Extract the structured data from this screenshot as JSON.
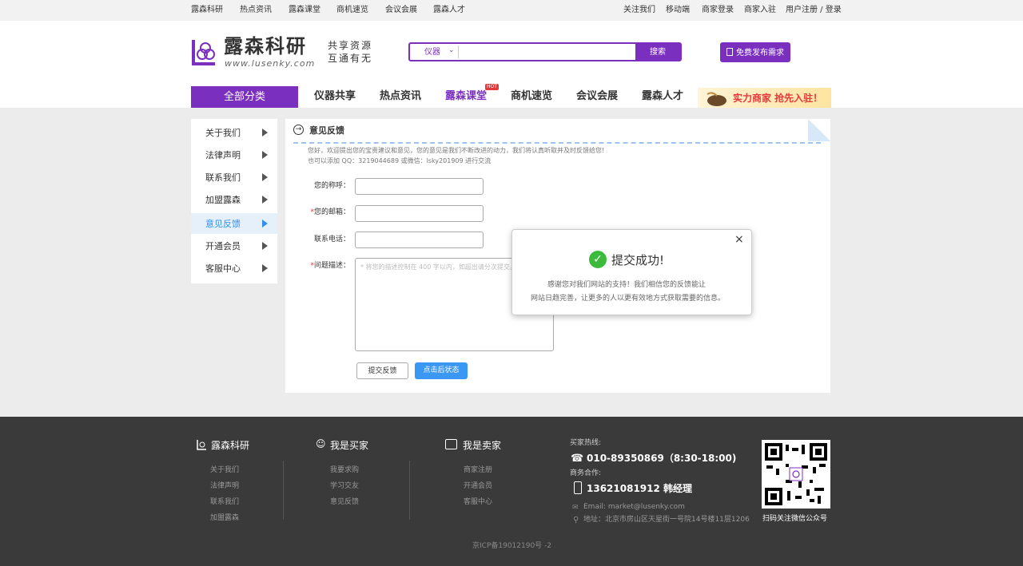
{
  "topbar": {
    "left": [
      "露森科研",
      "热点资讯",
      "露森课堂",
      "商机速览",
      "会议会展",
      "露森人才"
    ],
    "right": [
      "关注我们",
      "移动端",
      "商家登录",
      "商家入驻",
      "用户注册 / 登录"
    ]
  },
  "header": {
    "logo_main": "露森科研",
    "logo_url": "www.lusenky.com",
    "slogan_1": "共享资源",
    "slogan_2": "互通有无",
    "search_category": "仪器",
    "search_placeholder": "",
    "search_button": "搜索",
    "publish_button": "免费发布需求"
  },
  "nav": {
    "all_category": "全部分类",
    "items": [
      "仪器共享",
      "热点资讯",
      "露森课堂",
      "商机速览",
      "会议会展",
      "露森人才"
    ],
    "hot_badge": "HOT",
    "banner_text": "实力商家 抢先入驻！"
  },
  "sidebar": {
    "items": [
      "关于我们",
      "法律声明",
      "联系我们",
      "加盟露森",
      "意见反馈",
      "开通会员",
      "客服中心"
    ],
    "active": "意见反馈"
  },
  "panel": {
    "title": "意见反馈",
    "intro_1": "您好，欢迎提出您的宝贵建议和意见，您的意见是我们不断改进的动力，我们将认真听取并及时反馈给您!",
    "intro_2": "也可以添加 QQ：3219044689 或微信：lsky201909 进行交流",
    "form": {
      "name_label": "您的称呼：",
      "email_label": "您的邮箱：",
      "phone_label": "联系电话：",
      "desc_label": "问题描述：",
      "required_mark": "*",
      "desc_placeholder": "* 将您的描述控制在 400 字以内，如超出请分次提交。"
    },
    "submit_button": "提交反馈",
    "state_button": "点击后状态"
  },
  "modal": {
    "close": "×",
    "title": "提交成功!",
    "line_1": "感谢您对我们网站的支持！我们相信您的反馈能让",
    "line_2": "网站日趋完善，让更多的人以更有效地方式获取需要的信息。"
  },
  "footer": {
    "col1_title": "露森科研",
    "col1_links": [
      "关于我们",
      "法律声明",
      "联系我们",
      "加盟露森"
    ],
    "col2_title": "我是买家",
    "col2_links": [
      "我要求购",
      "学习交友",
      "意见反馈"
    ],
    "col3_title": "我是卖家",
    "col3_links": [
      "商家注册",
      "开通会员",
      "客服中心"
    ],
    "hotline_label": "买家热线:",
    "hotline": "010-89350869（8:30-18:00)",
    "biz_label": "商务合作:",
    "biz_phone": "13621081912 韩经理",
    "email": "Email: market@lusenky.com",
    "address": "地址：北京市房山区天星街一号院14号楼11层1206",
    "qr_caption": "扫码关注微信公众号",
    "icp": "京ICP备19012190号 -2"
  },
  "colors": {
    "brand": "#7b2fbf",
    "active_blue": "#2f8ff0",
    "button_blue": "#3a97f3",
    "success": "#3cba3c"
  }
}
